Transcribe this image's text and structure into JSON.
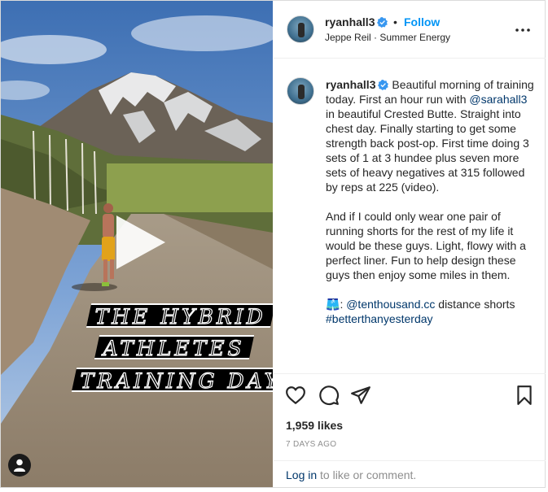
{
  "header": {
    "username": "ryanhall3",
    "follow_label": "Follow",
    "separator": "•",
    "audio": "Jeppe Reil · Summer Energy"
  },
  "media": {
    "title_lines": [
      "THE HYBRID",
      "ATHLETES",
      "TRAINING DAY"
    ],
    "type": "video"
  },
  "caption": {
    "username": "ryanhall3",
    "p1_a": " Beautiful morning of training today. First an hour run with ",
    "p1_mention": "@sarahall3",
    "p1_b": " in beautiful Crested Butte. Straight into chest day. Finally starting to get some strength back post-op. First time doing 3 sets of 1 at 3 hundee plus seven more sets of heavy negatives at 315 followed by reps at 225 (video).",
    "p2": "And if I could only wear one pair of running shorts for the rest of my life it would be these guys. Light, flowy with a perfect liner. Fun to help design these guys then enjoy some miles in them.",
    "p3_emoji": "🩳",
    "p3_colon": ": ",
    "p3_mention": "@tenthousand.cc",
    "p3_rest": " distance shorts",
    "hashtag": "#betterthanyesterday"
  },
  "stats": {
    "likes": "1,959 likes",
    "posted": "7 DAYS AGO"
  },
  "footer": {
    "login_link": "Log in",
    "login_rest": " to like or comment."
  },
  "colors": {
    "link_blue": "#0095f6",
    "mention_blue": "#00376b",
    "verified_blue": "#3897f0",
    "muted": "#8e8e8e"
  },
  "icons": [
    "heart-icon",
    "comment-icon",
    "share-icon",
    "bookmark-icon",
    "more-icon",
    "verified-icon",
    "play-icon",
    "user-tag-icon"
  ]
}
